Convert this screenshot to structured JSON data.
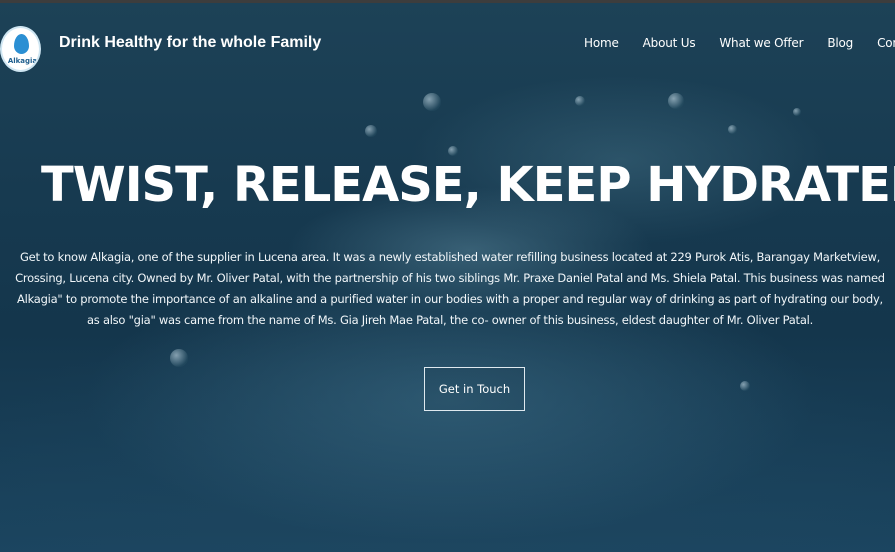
{
  "brand": {
    "logo_text": "Alkagia",
    "title": "Drink Healthy for the whole Family"
  },
  "nav": {
    "items": [
      {
        "label": "Home"
      },
      {
        "label": "About Us"
      },
      {
        "label": "What we Offer"
      },
      {
        "label": "Blog"
      },
      {
        "label": "Contact"
      }
    ]
  },
  "hero": {
    "headline": "TWIST, RELEASE, KEEP HYDRATED",
    "paragraph_lines": [
      "Get to know Alkagia, one of the supplier in Lucena area. It was a newly established water refilling business located at 229 Purok Atis, Barangay Marketview,",
      "Crossing, Lucena city. Owned by Mr. Oliver Patal, with the partnership of his two siblings Mr. Praxe Daniel Patal and Ms. Shiela Patal. This business was named",
      "Alkagia\" to promote the importance of an alkaline and a purified water in our bodies with a proper and regular way of drinking as part of hydrating our body,",
      "as also \"gia\" was came from the name of Ms. Gia Jireh Mae Patal, the co- owner of this business, eldest daughter of Mr. Oliver Patal."
    ],
    "cta_label": "Get in Touch"
  },
  "colors": {
    "background": "#173a50",
    "text": "#ffffff",
    "logo_drop": "#2b8fd3"
  }
}
